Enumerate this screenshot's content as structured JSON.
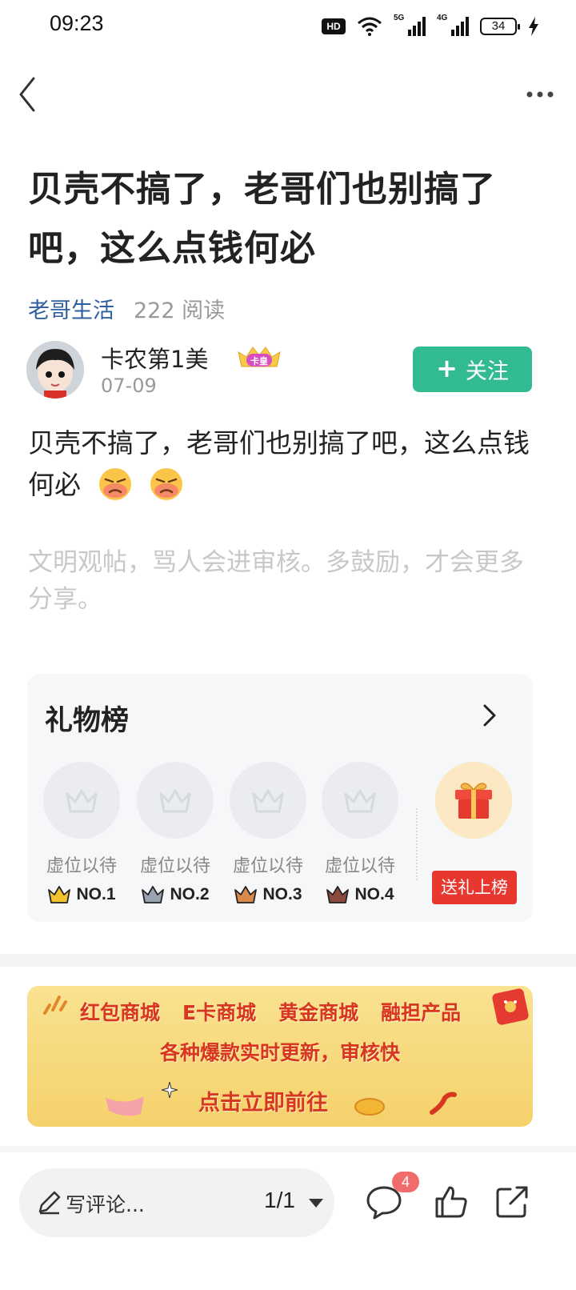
{
  "status_bar": {
    "time": "09:23",
    "hd_label": "HD",
    "sim1_label": "5G",
    "sim2_label": "4G",
    "battery": "34",
    "icons": [
      "hd-icon",
      "wifi-icon",
      "signal-5g-icon",
      "signal-4g-icon",
      "battery-icon",
      "charging-icon"
    ]
  },
  "nav": {
    "back_icon": "chevron-left-icon",
    "more_icon": "more-dots-icon"
  },
  "post": {
    "title": "贝壳不搞了，老哥们也别搞了吧，这么点钱何必",
    "topic": "老哥生活",
    "reads": "222 阅读",
    "author": {
      "name": "卡农第1美",
      "badge": "卡皇",
      "date": "07-09"
    },
    "follow_label": "关注",
    "content": "贝壳不搞了，老哥们也别搞了吧，这么点钱何必",
    "emojis": [
      "angry-face-icon",
      "angry-face-icon"
    ],
    "notice": "文明观帖，骂人会进审核。多鼓励，才会更多分享。"
  },
  "gift_board": {
    "title": "礼物榜",
    "slots": [
      {
        "label": "虚位以待",
        "rank": "NO.1",
        "crown_color": "#f2c230"
      },
      {
        "label": "虚位以待",
        "rank": "NO.2",
        "crown_color": "#9aa3b2"
      },
      {
        "label": "虚位以待",
        "rank": "NO.3",
        "crown_color": "#d98a4a"
      },
      {
        "label": "虚位以待",
        "rank": "NO.4",
        "crown_color": "#8a4a3c"
      }
    ],
    "send_label": "送礼上榜"
  },
  "banner": {
    "items": [
      "红包商城",
      "E卡商城",
      "黄金商城",
      "融担产品"
    ],
    "subtitle": "各种爆款实时更新，审核快",
    "cta": "点击立即前往"
  },
  "bottom_bar": {
    "comment_placeholder": "写评论...",
    "page": "1/1",
    "comment_count": "4",
    "icons": [
      "pen-icon",
      "comment-icon",
      "thumbs-up-icon",
      "share-icon"
    ]
  },
  "colors": {
    "accent": "#32bb93",
    "topic": "#2f5fa0",
    "red": "#e7372e",
    "banner": "#f5d16b"
  }
}
